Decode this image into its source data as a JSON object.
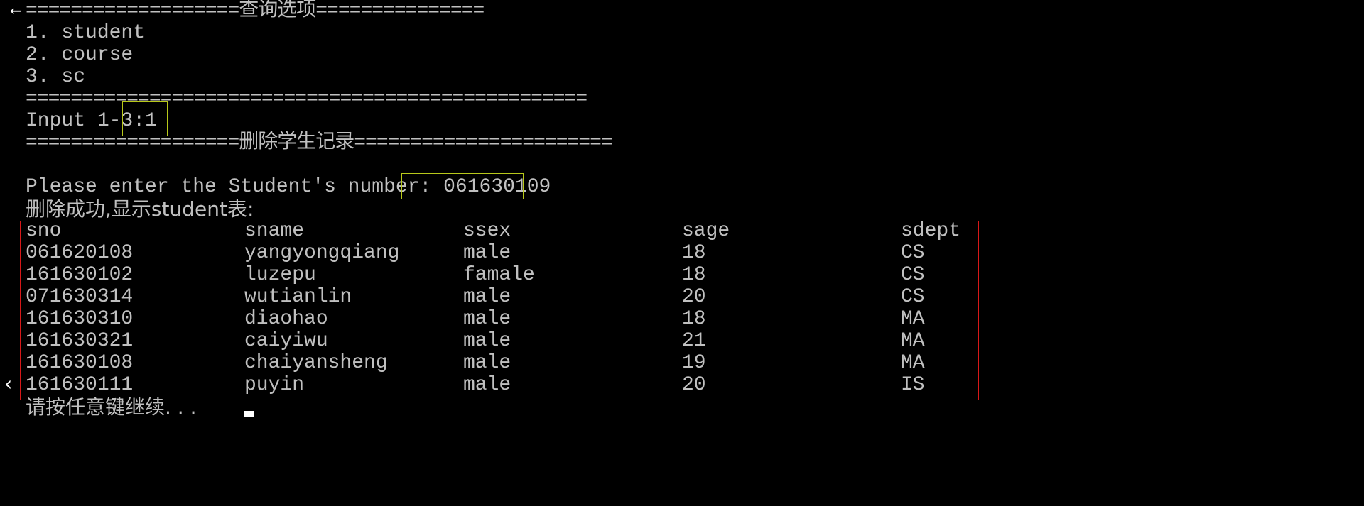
{
  "nav": {
    "back_glyph": "←",
    "scroll_left_glyph": "‹"
  },
  "menu": {
    "header": "===================查询选项===============",
    "items": [
      "1. student",
      "2. course",
      "3. sc"
    ],
    "footer": "=================================================="
  },
  "input": {
    "prompt": "Input 1-3",
    "value": ":1"
  },
  "delete_header": "===================删除学生记录=======================",
  "student_number": {
    "prompt": "Please enter the Student's number: ",
    "value": "061630109"
  },
  "result_message": "删除成功,显示student表:",
  "table": {
    "columns": [
      "sno",
      "sname",
      "ssex",
      "sage",
      "sdept"
    ],
    "rows": [
      [
        "061620108",
        "yangyongqiang",
        "male",
        "18",
        "CS"
      ],
      [
        "161630102",
        "luzepu",
        "famale",
        "18",
        "CS"
      ],
      [
        "071630314",
        "wutianlin",
        "male",
        "20",
        "CS"
      ],
      [
        "161630310",
        "diaohao",
        "male",
        "18",
        "MA"
      ],
      [
        "161630321",
        "caiyiwu",
        "male",
        "21",
        "MA"
      ],
      [
        "161630108",
        "chaiyansheng",
        "male",
        "19",
        "MA"
      ],
      [
        "161630111",
        "puyin",
        "male",
        "20",
        "IS"
      ]
    ]
  },
  "continue_prompt": "请按任意键继续. . .",
  "colors": {
    "background": "#000000",
    "text": "#c0c0c0",
    "highlight_yellow": "#b8c81a",
    "highlight_red": "#d81818"
  }
}
